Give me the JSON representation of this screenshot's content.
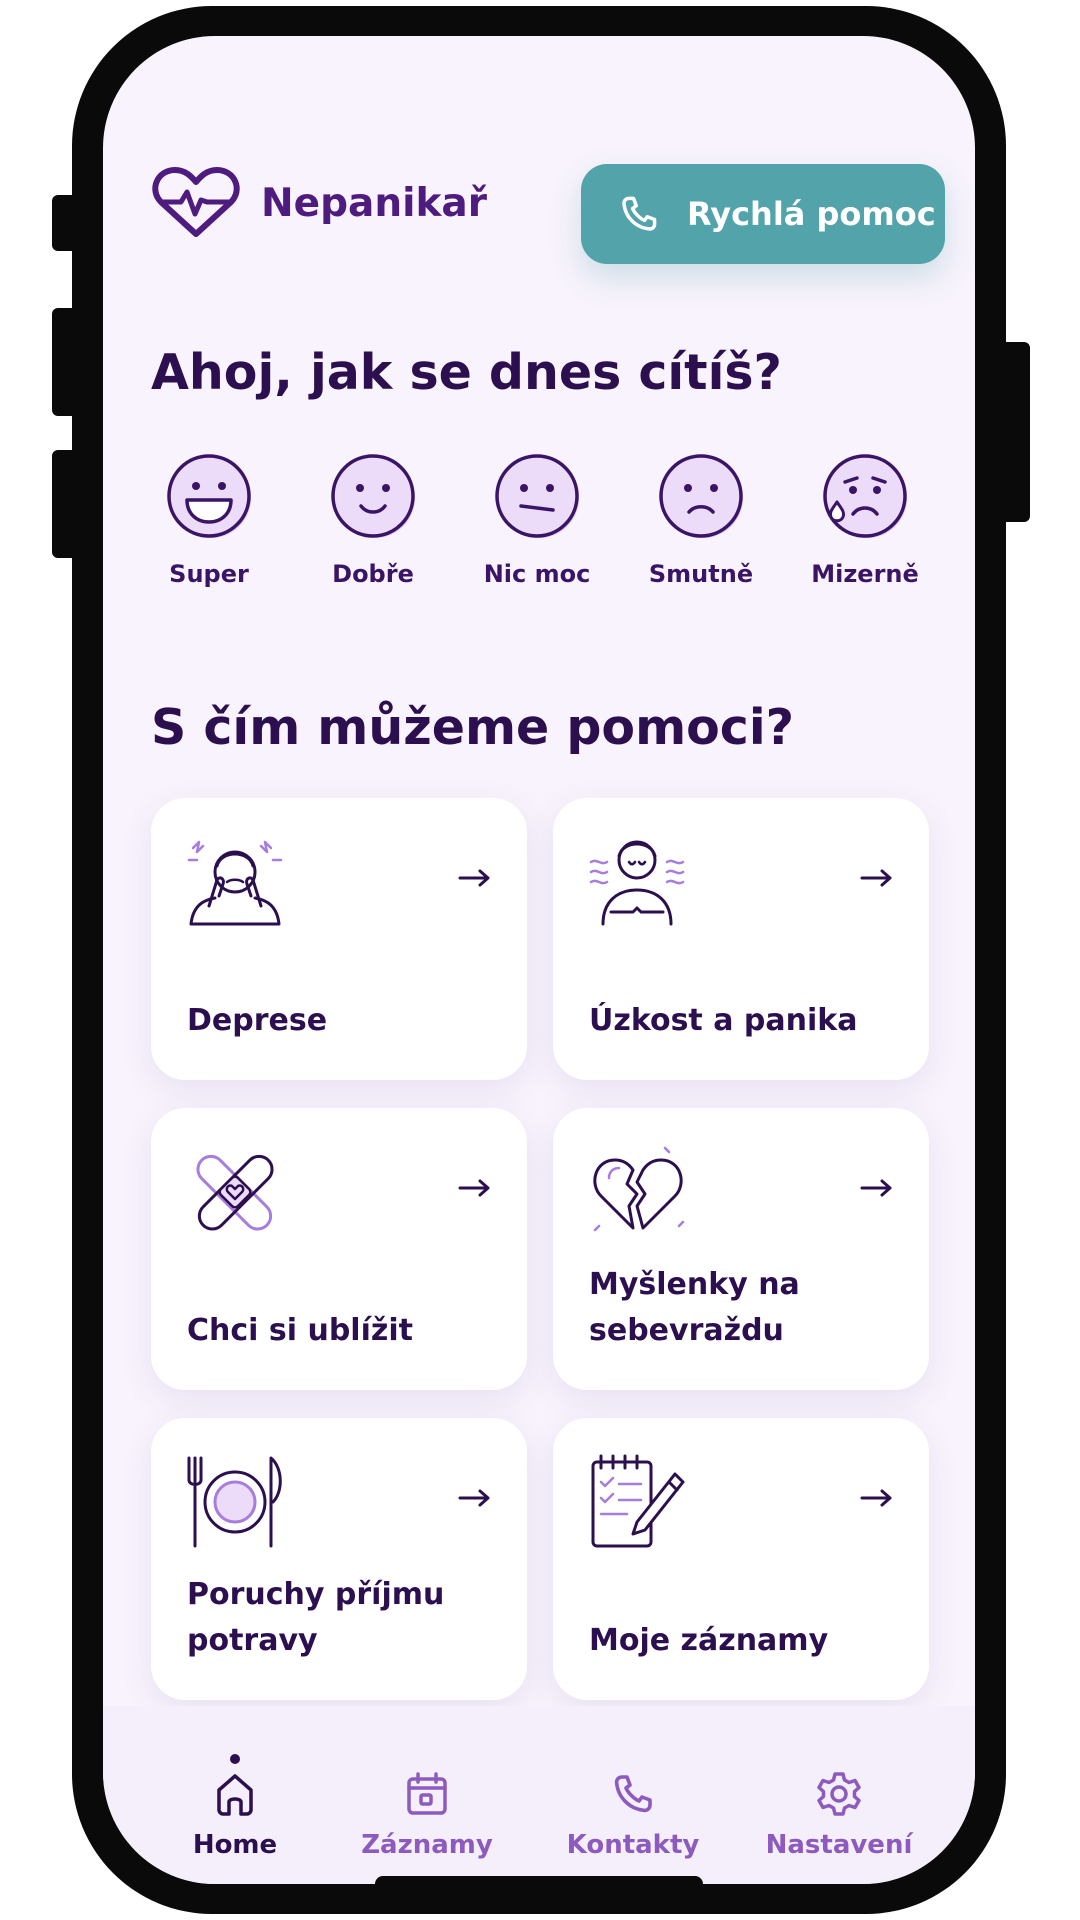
{
  "app": {
    "name": "Nepanikař"
  },
  "header": {
    "quick_help_label": "Rychlá pomoc"
  },
  "greeting": "Ahoj, jak se dnes cítíš?",
  "moods": [
    {
      "label": "Super",
      "icon": "very-happy-face-icon"
    },
    {
      "label": "Dobře",
      "icon": "smiling-face-icon"
    },
    {
      "label": "Nic moc",
      "icon": "neutral-face-icon"
    },
    {
      "label": "Smutně",
      "icon": "sad-face-icon"
    },
    {
      "label": "Mizerně",
      "icon": "crying-face-icon"
    }
  ],
  "help": {
    "title": "S čím můžeme pomoci?",
    "cards": [
      {
        "label": "Deprese",
        "icon": "stressed-person-icon"
      },
      {
        "label": "Úzkost a panika",
        "icon": "anxious-person-icon"
      },
      {
        "label": "Chci si ublížit",
        "icon": "bandage-heart-icon"
      },
      {
        "label": "Myšlenky na sebevraždu",
        "icon": "broken-heart-icon"
      },
      {
        "label": "Poruchy příjmu potravy",
        "icon": "plate-cutlery-icon"
      },
      {
        "label": "Moje záznamy",
        "icon": "notepad-pencil-icon"
      }
    ]
  },
  "tabbar": {
    "items": [
      {
        "label": "Home",
        "icon": "home-icon",
        "active": true
      },
      {
        "label": "Záznamy",
        "icon": "calendar-icon",
        "active": false
      },
      {
        "label": "Kontakty",
        "icon": "phone-icon",
        "active": false
      },
      {
        "label": "Nastavení",
        "icon": "gear-icon",
        "active": false
      }
    ]
  },
  "colors": {
    "primary_dark": "#2c0f4e",
    "brand_purple": "#4e1b7e",
    "accent_light_purple": "#c9a8ee",
    "teal_button": "#53a3aa",
    "screen_bg": "#f8f3fc",
    "card_bg": "#ffffff",
    "inactive_tab": "#8c5bbd"
  }
}
